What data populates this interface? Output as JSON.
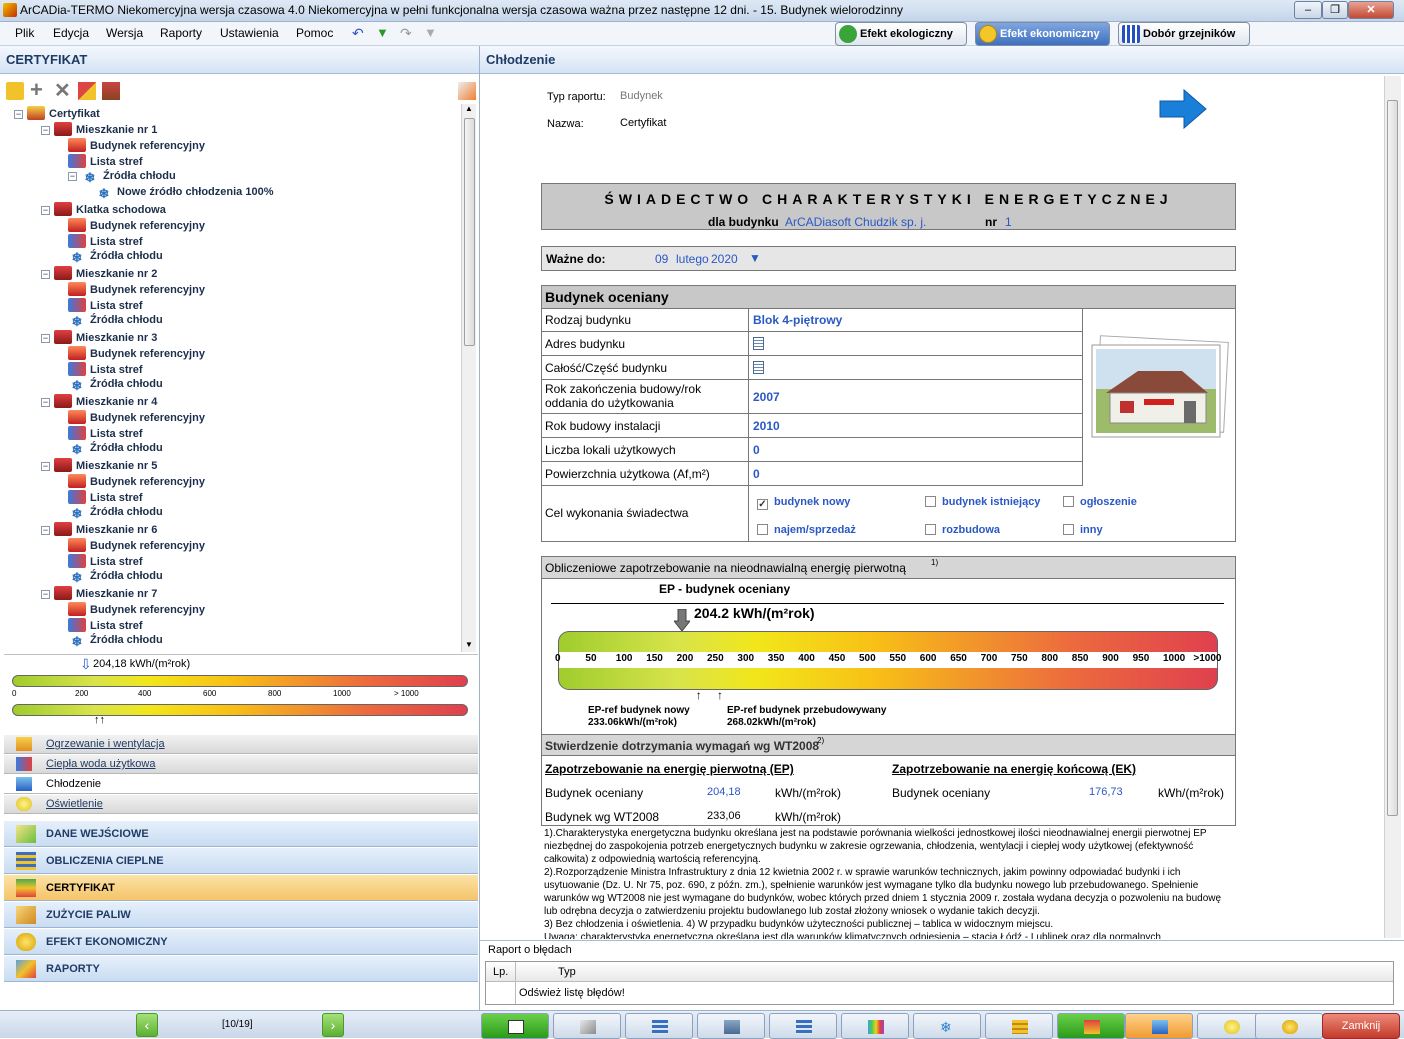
{
  "window": {
    "title": "ArCADia-TERMO Niekomercyjna wersja czasowa 4.0 Niekomercyjna w pełni funkcjonalna wersja czasowa ważna przez następne 12 dni. - 15. Budynek wielorodzinny",
    "controls": [
      "–",
      "❐",
      "✕"
    ]
  },
  "menu": [
    "Plik",
    "Edycja",
    "Wersja",
    "Raporty",
    "Ustawienia",
    "Pomoc"
  ],
  "topButtons": [
    "Efekt ekologiczny",
    "Efekt ekonomiczny",
    "Dobór grzejników"
  ],
  "left": {
    "header": "CERTYFIKAT",
    "tree": [
      {
        "label": "Certyfikat"
      },
      {
        "label": "Mieszkanie nr 1"
      },
      {
        "label": "Budynek referencyjny"
      },
      {
        "label": "Lista stref"
      },
      {
        "label": "Źródła chłodu"
      },
      {
        "label": "Nowe źródło chłodzenia 100%"
      },
      {
        "label": "Klatka schodowa"
      },
      {
        "label": "Budynek referencyjny"
      },
      {
        "label": "Lista stref"
      },
      {
        "label": "Źródła chłodu"
      },
      {
        "label": "Mieszkanie nr 2"
      },
      {
        "label": "Budynek referencyjny"
      },
      {
        "label": "Lista stref"
      },
      {
        "label": "Źródła chłodu"
      },
      {
        "label": "Mieszkanie nr 3"
      },
      {
        "label": "Budynek referencyjny"
      },
      {
        "label": "Lista stref"
      },
      {
        "label": "Źródła chłodu"
      },
      {
        "label": "Mieszkanie nr 4"
      },
      {
        "label": "Budynek referencyjny"
      },
      {
        "label": "Lista stref"
      },
      {
        "label": "Źródła chłodu"
      },
      {
        "label": "Mieszkanie nr 5"
      },
      {
        "label": "Budynek referencyjny"
      },
      {
        "label": "Lista stref"
      },
      {
        "label": "Źródła chłodu"
      },
      {
        "label": "Mieszkanie nr 6"
      },
      {
        "label": "Budynek referencyjny"
      },
      {
        "label": "Lista stref"
      },
      {
        "label": "Źródła chłodu"
      },
      {
        "label": "Mieszkanie nr 7"
      },
      {
        "label": "Budynek referencyjny"
      },
      {
        "label": "Lista stref"
      },
      {
        "label": "Źródła chłodu"
      }
    ],
    "miniScale": {
      "value": "204,18 kWh/(m²rok)",
      "ticks": [
        "0",
        "200",
        "400",
        "600",
        "800",
        "1000",
        "> 1000"
      ]
    },
    "categories": [
      "Ogrzewanie i wentylacja",
      "Ciepła woda użytkowa",
      "Chłodzenie",
      "Oświetlenie"
    ],
    "nav": [
      "DANE WEJŚCIOWE",
      "OBLICZENIA CIEPLNE",
      "CERTYFIKAT",
      "ZUŻYCIE PALIW",
      "EFEKT EKONOMICZNY",
      "RAPORTY"
    ],
    "pager": "[10/19]"
  },
  "right": {
    "header": "Chłodzenie",
    "report": {
      "typeLabel": "Typ raportu:",
      "typeValue": "Budynek",
      "nameLabel": "Nazwa:",
      "nameValue": "Certyfikat",
      "title": "ŚWIADECTWO CHARAKTERYSTYKI ENERGETYCZNEJ",
      "forLabel": "dla budynku",
      "company": "ArCADiasoft Chudzik sp. j.",
      "nrLabel": "nr",
      "nrValue": "1",
      "validLabel": "Ważne do:",
      "validDay": "09",
      "validMonth": "lutego",
      "validYear": "2020",
      "sectionTitle": "Budynek oceniany",
      "rows": [
        {
          "label": "Rodzaj budynku",
          "value": "Blok 4-piętrowy"
        },
        {
          "label": "Adres budynku",
          "value": ""
        },
        {
          "label": "Całość/Część budynku",
          "value": ""
        },
        {
          "label": "Rok zakończenia budowy/rok oddania do użytkowania",
          "value": "2007"
        },
        {
          "label": "Rok budowy instalacji",
          "value": "2010"
        },
        {
          "label": "Liczba lokali użytkowych",
          "value": "0"
        },
        {
          "label": "Powierzchnia użytkowa (Af,m²)",
          "value": "0"
        }
      ],
      "purposeLabel": "Cel wykonania świadectwa",
      "purposes": [
        {
          "label": "budynek nowy",
          "checked": true
        },
        {
          "label": "budynek istniejący",
          "checked": false
        },
        {
          "label": "ogłoszenie",
          "checked": false
        },
        {
          "label": "najem/sprzedaż",
          "checked": false
        },
        {
          "label": "rozbudowa",
          "checked": false
        },
        {
          "label": "inny",
          "checked": false
        }
      ],
      "demandTitle": "Obliczeniowe zapotrzebowanie na nieodnawialną energię pierwotną",
      "demandSup": "1)",
      "epLabel": "EP - budynek oceniany",
      "epValue": "204.2 kWh/(m²rok)",
      "ep": 204.2,
      "scaleTicks": [
        "0",
        "50",
        "100",
        "150",
        "200",
        "250",
        "300",
        "350",
        "400",
        "450",
        "500",
        "550",
        "600",
        "650",
        "700",
        "750",
        "800",
        "850",
        "900",
        "950",
        "1000",
        ">1000"
      ],
      "refNew": {
        "label": "EP-ref budynek nowy",
        "value": "233.06kWh/(m²rok)",
        "ep": 233.06
      },
      "refMod": {
        "label": "EP-ref budynek przebudowywany",
        "value": "268.02kWh/(m²rok)",
        "ep": 268.02
      },
      "complianceTitle": "Stwierdzenie dotrzymania wymagań wg WT2008",
      "complianceSup": "2)",
      "epHeader": "Zapotrzebowanie na energię pierwotną (EP)",
      "ekHeader": "Zapotrzebowanie na energię końcową (EK)",
      "epRows": [
        {
          "label": "Budynek oceniany",
          "value": "204,18",
          "unit": "kWh/(m²rok)"
        },
        {
          "label": "Budynek wg WT2008",
          "value": "233,06",
          "unit": "kWh/(m²rok)"
        }
      ],
      "ekRows": [
        {
          "label": "Budynek oceniany",
          "value": "176,73",
          "unit": "kWh/(m²rok)"
        }
      ],
      "footnotes": [
        "1).Charakterystyka energetyczna budynku określana jest na podstawie porównania wielkości jednostkowej ilości nieodnawialnej energii pierwotnej EP niezbędnej do zaspokojenia potrzeb energetycznych budynku w zakresie ogrzewania, chłodzenia, wentylacji i ciepłej wody użytkowej (efektywność całkowita) z odpowiednią wartością referencyjną.",
        "2).Rozporządzenie Ministra Infrastruktury z dnia 12 kwietnia 2002 r. w sprawie warunków technicznych, jakim powinny odpowiadać budynki i ich usytuowanie (Dz. U. Nr 75, poz. 690, z późn. zm.), spełnienie warunków jest wymagane tylko dla budynku nowego lub przebudowanego. Spełnienie warunków wg WT2008 nie jest wymagane do budynków, wobec których przed dniem 1 stycznia 2009 r. została wydana decyzja o pozwoleniu na budowę lub odrębna decyzja o zatwierdzeniu projektu budowlanego lub został złożony wniosek o wydanie takich decyzji.",
        "3) Bez chłodzenia i oświetlenia. 4) W przypadku budynków użyteczności publicznej – tablica w widocznym miejscu.",
        "Uwaga: charakterystyka energetyczna określana jest dla warunków klimatycznych odniesienia – stacja Łódź - Lublinek oraz dla normalnych"
      ]
    },
    "errorPanel": {
      "title": "Raport o błędach",
      "colLp": "Lp.",
      "colTyp": "Typ",
      "refresh": "Odśwież listę błędów!"
    }
  },
  "status": {
    "close": "Zamknij"
  }
}
